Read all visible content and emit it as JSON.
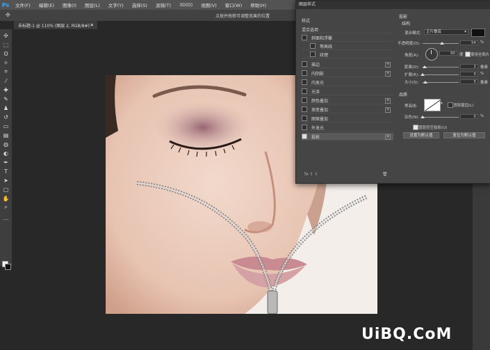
{
  "app": {
    "logo": "Ps"
  },
  "menubar": {
    "items": [
      "文件(F)",
      "编辑(E)",
      "图像(I)",
      "图层(L)",
      "文字(Y)",
      "选择(S)",
      "滤镜(T)",
      "3D(D)",
      "视图(V)",
      "窗口(W)",
      "帮助(H)"
    ]
  },
  "options": {
    "hint": "点按并拖移可调整效果的位置"
  },
  "document": {
    "tab": "未标题-1 @ 110% (图层 2, RGB/8#) *",
    "close": "×"
  },
  "dialog": {
    "title": "图层样式",
    "styles_header": "样式",
    "blend_options": "混合选项",
    "items": [
      {
        "label": "斜面和浮雕",
        "checked": false,
        "plus": false
      },
      {
        "label": "等高线",
        "checked": false,
        "plus": false,
        "indent": true
      },
      {
        "label": "纹理",
        "checked": false,
        "plus": false,
        "indent": true
      },
      {
        "label": "描边",
        "checked": false,
        "plus": true
      },
      {
        "label": "内阴影",
        "checked": false,
        "plus": true
      },
      {
        "label": "内发光",
        "checked": false,
        "plus": false
      },
      {
        "label": "光泽",
        "checked": false,
        "plus": false
      },
      {
        "label": "颜色叠加",
        "checked": false,
        "plus": true
      },
      {
        "label": "渐变叠加",
        "checked": false,
        "plus": true
      },
      {
        "label": "图案叠加",
        "checked": false,
        "plus": false
      },
      {
        "label": "外发光",
        "checked": false,
        "plus": false
      },
      {
        "label": "投影",
        "checked": true,
        "plus": true,
        "active": true
      }
    ],
    "bottom_icons": "fx  ⇧  ⇩",
    "shadow": {
      "section": "投影",
      "structure": "结构",
      "blend_mode_label": "混合模式:",
      "blend_mode_value": "正片叠底",
      "blend_color": "#111111",
      "opacity_label": "不透明度(O):",
      "opacity_value": "54",
      "opacity_unit": "%",
      "opacity_level": 0.54,
      "angle_label": "角度(A):",
      "angle_value": "90",
      "angle_unit": "度",
      "global_light_label": "使用全局光",
      "distance_label": "距离(D):",
      "distance_value": "2",
      "distance_unit": "像素",
      "distance_level": 0.05,
      "spread_label": "扩展(R):",
      "spread_value": "0",
      "spread_unit": "%",
      "spread_level": 0.0,
      "size_label": "大小(S):",
      "size_value": "5",
      "size_unit": "像素",
      "size_level": 0.07,
      "quality": "品质",
      "contour_label": "等高线:",
      "antialias_label": "消除锯齿(L)",
      "noise_label": "杂色(N):",
      "noise_value": "0",
      "noise_unit": "%",
      "noise_level": 0.0,
      "knockout_label": "图层挖空投影(U)",
      "default_button": "设置为默认值",
      "reset_button": "复位为默认值"
    }
  },
  "watermark": "UiBQ.CoM"
}
